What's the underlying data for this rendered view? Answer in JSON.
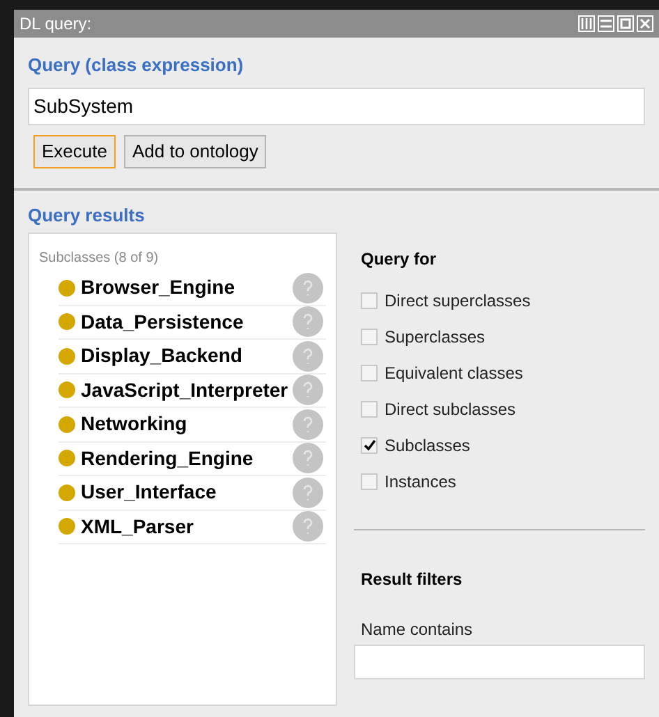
{
  "window": {
    "title": "DL query:"
  },
  "query": {
    "label": "Query (class expression)",
    "value": "SubSystem"
  },
  "buttons": [
    {
      "label": "Execute",
      "focused": true
    },
    {
      "label": "Add to ontology",
      "focused": false
    }
  ],
  "results": {
    "label": "Query results",
    "group": "Subclasses (8 of 9)",
    "items": [
      "Browser_Engine",
      "Data_Persistence",
      "Display_Backend",
      "JavaScript_Interpreter",
      "Networking",
      "Rendering_Engine",
      "User_Interface",
      "XML_Parser"
    ]
  },
  "query_for": {
    "label": "Query for",
    "options": [
      {
        "label": "Direct superclasses",
        "checked": false
      },
      {
        "label": "Superclasses",
        "checked": false
      },
      {
        "label": "Equivalent classes",
        "checked": false
      },
      {
        "label": "Direct subclasses",
        "checked": false
      },
      {
        "label": "Subclasses",
        "checked": true
      },
      {
        "label": "Instances",
        "checked": false
      }
    ]
  },
  "result_filters": {
    "label": "Result filters",
    "name_label": "Name contains"
  }
}
